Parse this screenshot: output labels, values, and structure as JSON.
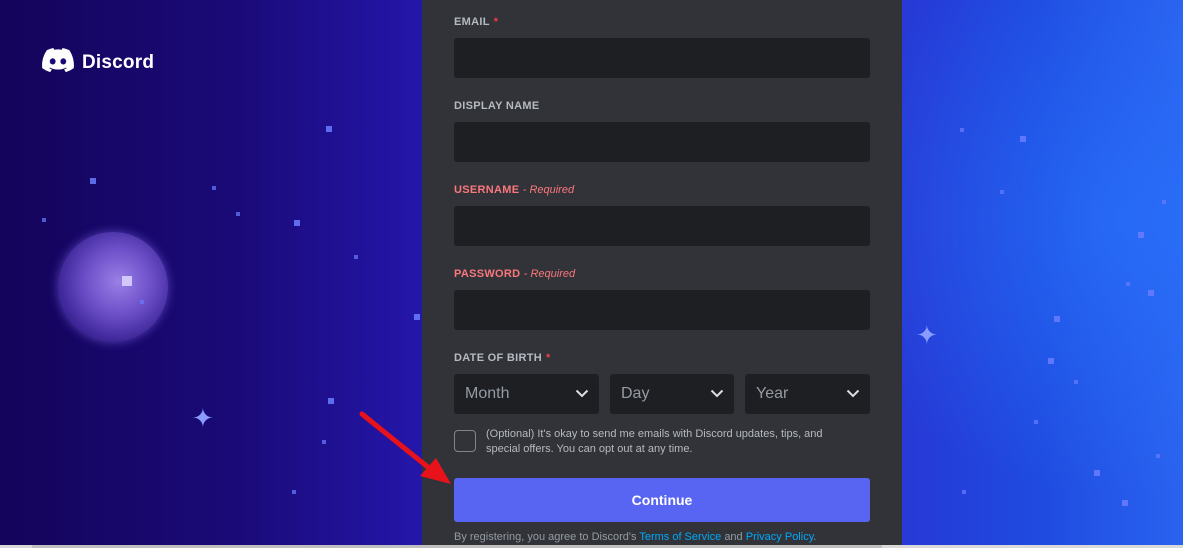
{
  "brand": {
    "name": "Discord",
    "icon": "discord-logo-icon"
  },
  "form": {
    "email": {
      "label": "EMAIL",
      "required_marker": "*",
      "value": ""
    },
    "display_name": {
      "label": "DISPLAY NAME",
      "value": ""
    },
    "username": {
      "label": "USERNAME",
      "note": "- Required",
      "value": ""
    },
    "password": {
      "label": "PASSWORD",
      "note": "- Required",
      "value": ""
    },
    "dob": {
      "label": "DATE OF BIRTH",
      "required_marker": "*",
      "month": "Month",
      "day": "Day",
      "year": "Year"
    },
    "optin_text": "(Optional) It's okay to send me emails with Discord updates, tips, and special offers. You can opt out at any time.",
    "continue_label": "Continue",
    "legal": {
      "prefix": "By registering, you agree to Discord's",
      "terms": "Terms of Service",
      "and": "and",
      "privacy": "Privacy Policy",
      "suffix": "."
    }
  },
  "colors": {
    "panel": "#313338",
    "input": "#1e1f22",
    "button": "#5865f2",
    "error": "#fa777c",
    "link": "#00a8fc",
    "arrow": "#e8121b"
  },
  "annotation": {
    "icon": "red-arrow-icon",
    "target": "continue-button"
  }
}
